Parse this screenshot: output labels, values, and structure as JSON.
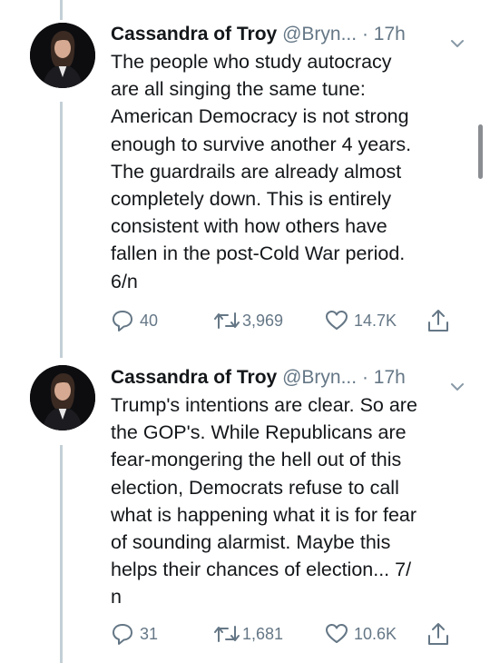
{
  "tweets": [
    {
      "display_name": "Cassandra of Troy",
      "handle": "@Bryn...",
      "separator": "·",
      "time": "17h",
      "text": "The people who study autocracy\nare all singing the same tune:\nAmerican Democracy is not strong\nenough to survive another 4 years.\nThe guardrails are already almost\ncompletely down. This is entirely\nconsistent with how others have\nfallen in the post-Cold War period.\n6/n",
      "replies": "40",
      "retweets": "3,969",
      "likes": "14.7K"
    },
    {
      "display_name": "Cassandra of Troy",
      "handle": "@Bryn...",
      "separator": "·",
      "time": "17h",
      "text": "Trump's intentions are clear. So are\nthe GOP's. While Republicans are\nfear-mongering the hell out of this\nelection, Democrats refuse to call\nwhat is happening what it is for fear\nof sounding alarmist. Maybe this\nhelps their chances of election... 7/\nn",
      "replies": "31",
      "retweets": "1,681",
      "likes": "10.6K"
    }
  ],
  "icons": {
    "reply": "reply-icon",
    "retweet": "retweet-icon",
    "like": "heart-icon",
    "share": "share-icon",
    "more": "chevron-down-icon"
  },
  "colors": {
    "text": "#14171a",
    "secondary": "#657786",
    "thread_line": "#c4cfd6"
  }
}
